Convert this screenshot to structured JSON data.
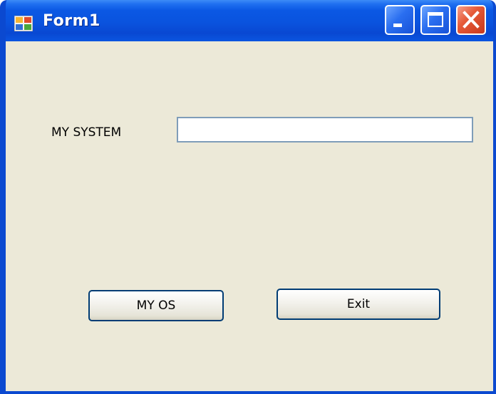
{
  "window": {
    "title": "Form1",
    "controls": {
      "minimize_icon": "minimize-icon",
      "maximize_icon": "maximize-icon",
      "close_icon": "close-icon"
    }
  },
  "form": {
    "system_label": "MY SYSTEM",
    "system_input_value": "",
    "myos_button_label": "MY OS",
    "exit_button_label": "Exit"
  },
  "colors": {
    "titlebar_blue": "#0a53de",
    "client_background": "#ece9d8",
    "close_button_red": "#e65a38",
    "textbox_border": "#7f9db9",
    "button_border": "#003c74"
  }
}
